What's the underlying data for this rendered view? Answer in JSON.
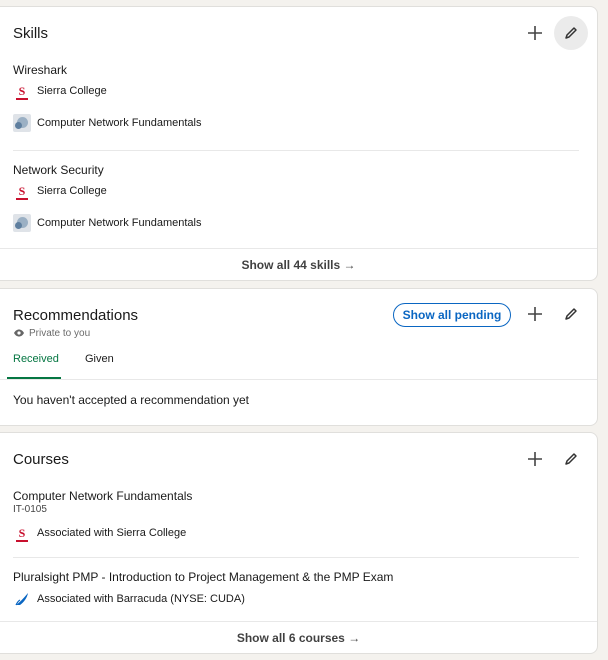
{
  "skills": {
    "title": "Skills",
    "items": [
      {
        "name": "Wireshark",
        "school": "Sierra College",
        "course": "Computer Network Fundamentals"
      },
      {
        "name": "Network Security",
        "school": "Sierra College",
        "course": "Computer Network Fundamentals"
      }
    ],
    "show_all": "Show all 44 skills →"
  },
  "recommendations": {
    "title": "Recommendations",
    "visibility": "Private to you",
    "show_pending": "Show all pending",
    "tabs": [
      "Received",
      "Given"
    ],
    "active_tab": "Received",
    "empty_message": "You haven't accepted a recommendation yet"
  },
  "courses": {
    "title": "Courses",
    "items": [
      {
        "name": "Computer Network Fundamentals",
        "code": "IT-0105",
        "association": "Associated with Sierra College",
        "logo": "sierra-college-logo"
      },
      {
        "name": "Pluralsight PMP - Introduction to Project Management & the PMP Exam",
        "code": "",
        "association": "Associated with Barracuda (NYSE: CUDA)",
        "logo": "barracuda-logo"
      }
    ],
    "show_all": "Show all 6 courses →"
  },
  "colors": {
    "accent_blue": "#0a66c2",
    "accent_green": "#057642",
    "sierra_red": "#c8102e"
  }
}
